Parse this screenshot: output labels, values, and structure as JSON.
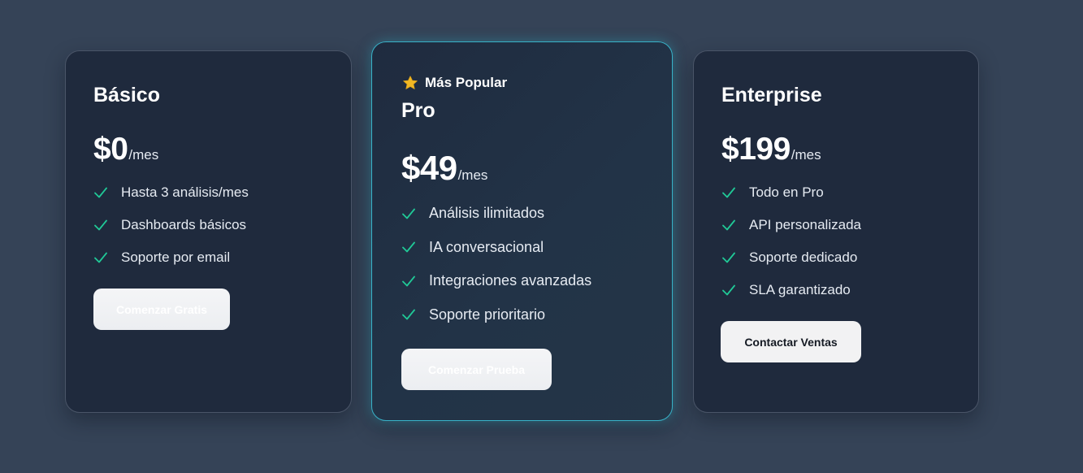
{
  "colors": {
    "background": "#354357",
    "card": "#1f2a3d",
    "accent_border": "#38b2c8",
    "check": "#20c997",
    "star": "#f2b824"
  },
  "plans": [
    {
      "name": "Básico",
      "price": "$0",
      "period": "/mes",
      "features": [
        "Hasta 3 análisis/mes",
        "Dashboards básicos",
        "Soporte por email"
      ],
      "cta": "Comenzar Gratis"
    },
    {
      "badge": "Más Popular",
      "badge_icon": "star-icon",
      "name": "Pro",
      "price": "$49",
      "period": "/mes",
      "features": [
        "Análisis ilimitados",
        "IA conversacional",
        "Integraciones avanzadas",
        "Soporte prioritario"
      ],
      "cta": "Comenzar Prueba"
    },
    {
      "name": "Enterprise",
      "price": "$199",
      "period": "/mes",
      "features": [
        "Todo en Pro",
        "API personalizada",
        "Soporte dedicado",
        "SLA garantizado"
      ],
      "cta": "Contactar Ventas"
    }
  ]
}
